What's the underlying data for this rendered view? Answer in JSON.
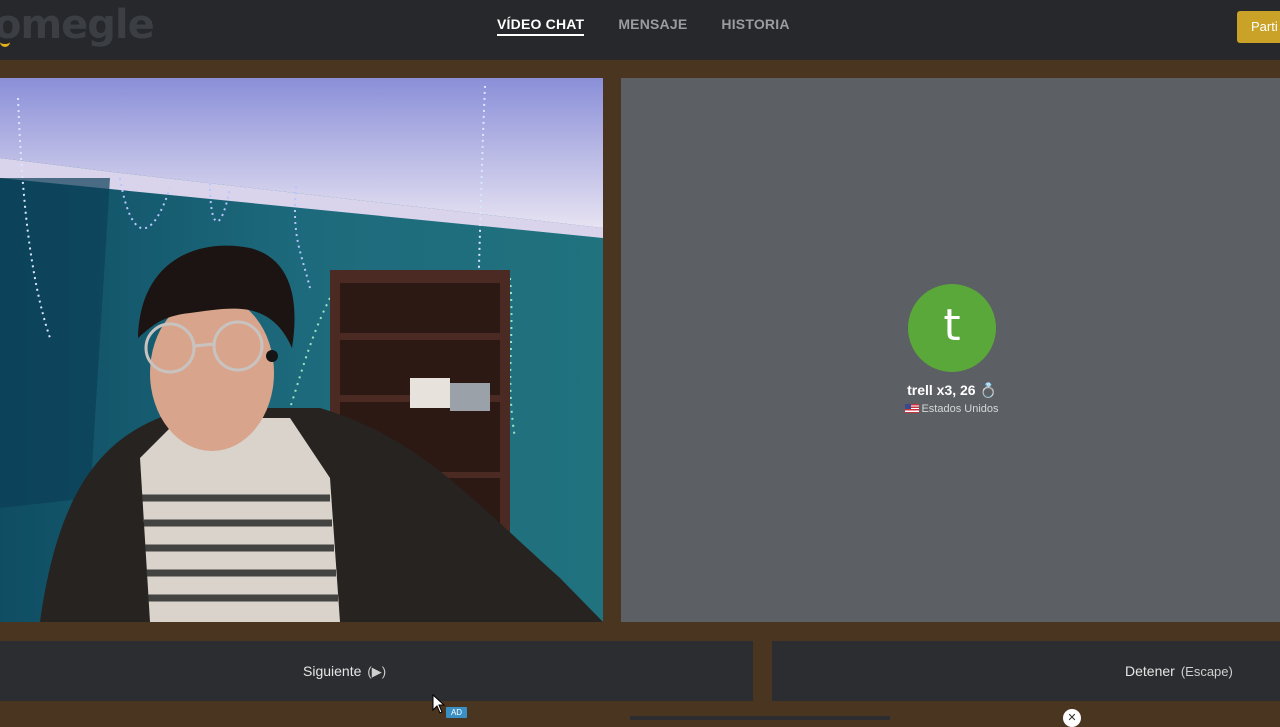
{
  "app": {
    "logo_text": "omegle"
  },
  "nav": {
    "items": [
      {
        "label": "VÍDEO CHAT",
        "active": true
      },
      {
        "label": "MENSAJE",
        "active": false
      },
      {
        "label": "HISTORIA",
        "active": false
      }
    ],
    "join_button": "Parti"
  },
  "remote": {
    "avatar_letter": "t",
    "name": "trell x3, 26 💍",
    "country": "Estados Unidos",
    "avatar_color": "#5aa83a"
  },
  "controls": {
    "next_label": "Siguiente",
    "next_key": "(▶)",
    "stop_label": "Detener",
    "stop_key": "(Escape)"
  },
  "ad": {
    "badge": "AD",
    "close": "✕"
  },
  "colors": {
    "accent": "#c9a227",
    "frame": "#4a3520",
    "panel": "#2b2d30"
  }
}
